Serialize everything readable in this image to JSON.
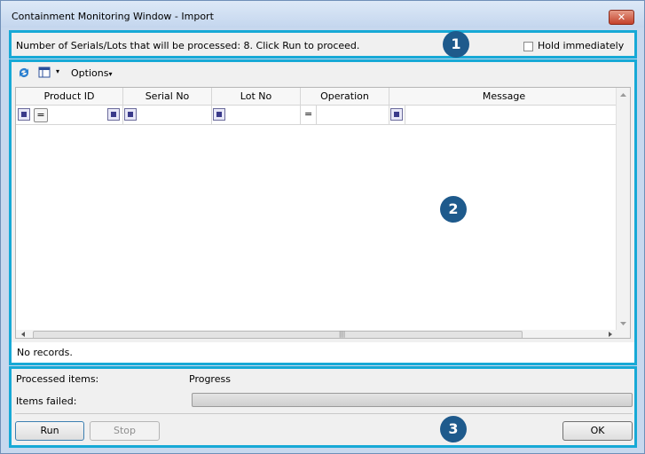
{
  "window": {
    "title": "Containment Monitoring Window - Import",
    "close_glyph": "✕"
  },
  "panel1": {
    "badge": "1",
    "message": "Number of Serials/Lots that will be processed: 8. Click Run to proceed.",
    "hold_label": "Hold immediately",
    "hold_checked": false
  },
  "panel2": {
    "badge": "2",
    "toolbar": {
      "options_label": "Options",
      "dropdown_glyph": "▾"
    },
    "columns": [
      "Product ID",
      "Serial No",
      "Lot No",
      "Operation",
      "Message"
    ],
    "filter_operator": "=",
    "status": "No records."
  },
  "panel3": {
    "badge": "3",
    "processed_label": "Processed items:",
    "progress_label": "Progress",
    "failed_label": "Items failed:",
    "progress": 0,
    "run_label": "Run",
    "stop_label": "Stop",
    "ok_label": "OK"
  },
  "icons": {
    "refresh": "refresh-icon",
    "column_chooser": "column-chooser-icon",
    "filter": "filter-icon"
  },
  "colors": {
    "accent": "#17a9d6",
    "badge": "#1e5a8c"
  }
}
